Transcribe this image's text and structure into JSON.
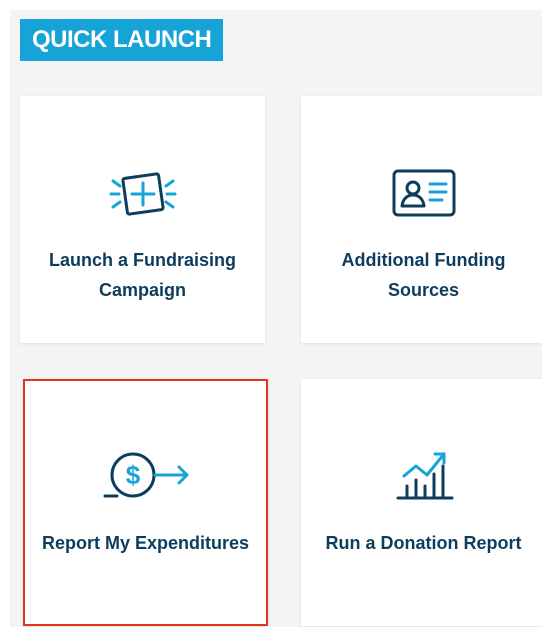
{
  "quick_launch": {
    "title": "QUICK LAUNCH",
    "tiles": [
      {
        "label": "Launch a Fundraising Campaign",
        "icon": "add-campaign-icon",
        "selected": false
      },
      {
        "label": "Additional Funding Sources",
        "icon": "id-card-icon",
        "selected": false
      },
      {
        "label": "Report My Expenditures",
        "icon": "dollar-arrow-icon",
        "selected": true
      },
      {
        "label": "Run a Donation Report",
        "icon": "growth-chart-icon",
        "selected": false
      }
    ]
  },
  "colors": {
    "accent": "#16a3d8",
    "text": "#0d3d5c",
    "icon_stroke": "#0d3d5c",
    "icon_accent": "#16a3d8",
    "selected_border": "#e5321f",
    "panel_background": "#f4f4f4"
  }
}
